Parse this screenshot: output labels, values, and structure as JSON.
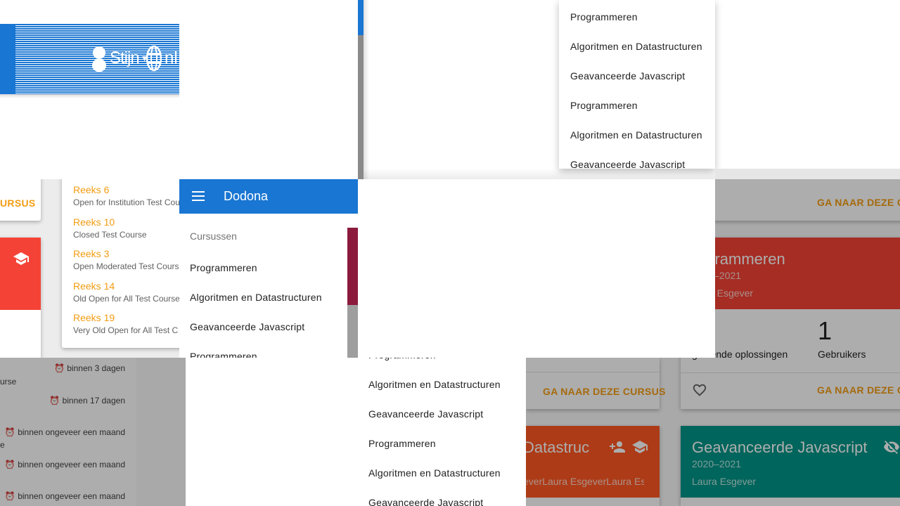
{
  "app": {
    "title": "Dodona"
  },
  "header": {
    "user": "Stijn",
    "language": "nl"
  },
  "sidebar": {
    "section_title": "Cursussen",
    "items": [
      {
        "label": "Programmeren"
      },
      {
        "label": "Algoritmen en Datastructuren"
      },
      {
        "label": "Geavanceerde Javascript"
      },
      {
        "label": "Programmeren"
      }
    ]
  },
  "top_menu": {
    "items": [
      {
        "label": "Programmeren"
      },
      {
        "label": "Algoritmen en Datastructuren"
      },
      {
        "label": "Geavanceerde Javascript"
      },
      {
        "label": "Programmeren"
      },
      {
        "label": "Algoritmen en Datastructuren"
      },
      {
        "label": "Geavanceerde Javascript"
      }
    ]
  },
  "bottom_menu": {
    "items": [
      {
        "label": "Programmeren"
      },
      {
        "label": "Algoritmen en Datastructuren"
      },
      {
        "label": "Geavanceerde Javascript"
      },
      {
        "label": "Programmeren"
      },
      {
        "label": "Algoritmen en Datastructuren"
      },
      {
        "label": "Geavanceerde Javascript"
      }
    ]
  },
  "reeksen": [
    {
      "title": "Reeks 6",
      "course": "Open for Institution Test Course"
    },
    {
      "title": "Reeks 10",
      "course": "Closed Test Course"
    },
    {
      "title": "Reeks 3",
      "course": "Open Moderated Test Course"
    },
    {
      "title": "Reeks 14",
      "course": "Old Open for All Test Course"
    },
    {
      "title": "Reeks 19",
      "course": "Very Old Open for All Test Course"
    }
  ],
  "deadlines": [
    {
      "label": "binnen 3 dagen",
      "course_fragment": "urse"
    },
    {
      "label": "binnen 17 dagen",
      "course_fragment": ""
    },
    {
      "label": "binnen ongeveer een maand",
      "course_fragment": "e"
    },
    {
      "label": "binnen ongeveer een maand",
      "course_fragment": ""
    },
    {
      "label": "binnen ongeveer een maand",
      "course_fragment": ""
    }
  ],
  "left_card": {
    "go_label": "URSUS"
  },
  "cards": {
    "go_label": "GA NAAR DEZE CURSUS",
    "programmeren": {
      "title": "Programmeren",
      "title_fragment": "ogrammeren",
      "year": "2020–2021",
      "teacher": "Laura Esgever",
      "teacher_fragment": "a Esgever",
      "users_count": "1",
      "users_label": "Gebruikers",
      "solutions_label": "Ingediende oplossingen",
      "solutions_fragment": "gediende oplossingen",
      "color": "#f44336"
    },
    "algoritmen": {
      "title_fragment": "Datastruc",
      "teacher_fragment": "everLaura EsgeverLaura Es",
      "color": "#ff5722"
    },
    "javascript": {
      "title": "Geavanceerde Javascript",
      "year": "2020–2021",
      "teacher": "Laura Esgever",
      "color": "#009688"
    }
  },
  "colors": {
    "primary": "#1976d2",
    "accent": "#f39c12",
    "overlay": "rgba(0,0,0,0.32)"
  }
}
